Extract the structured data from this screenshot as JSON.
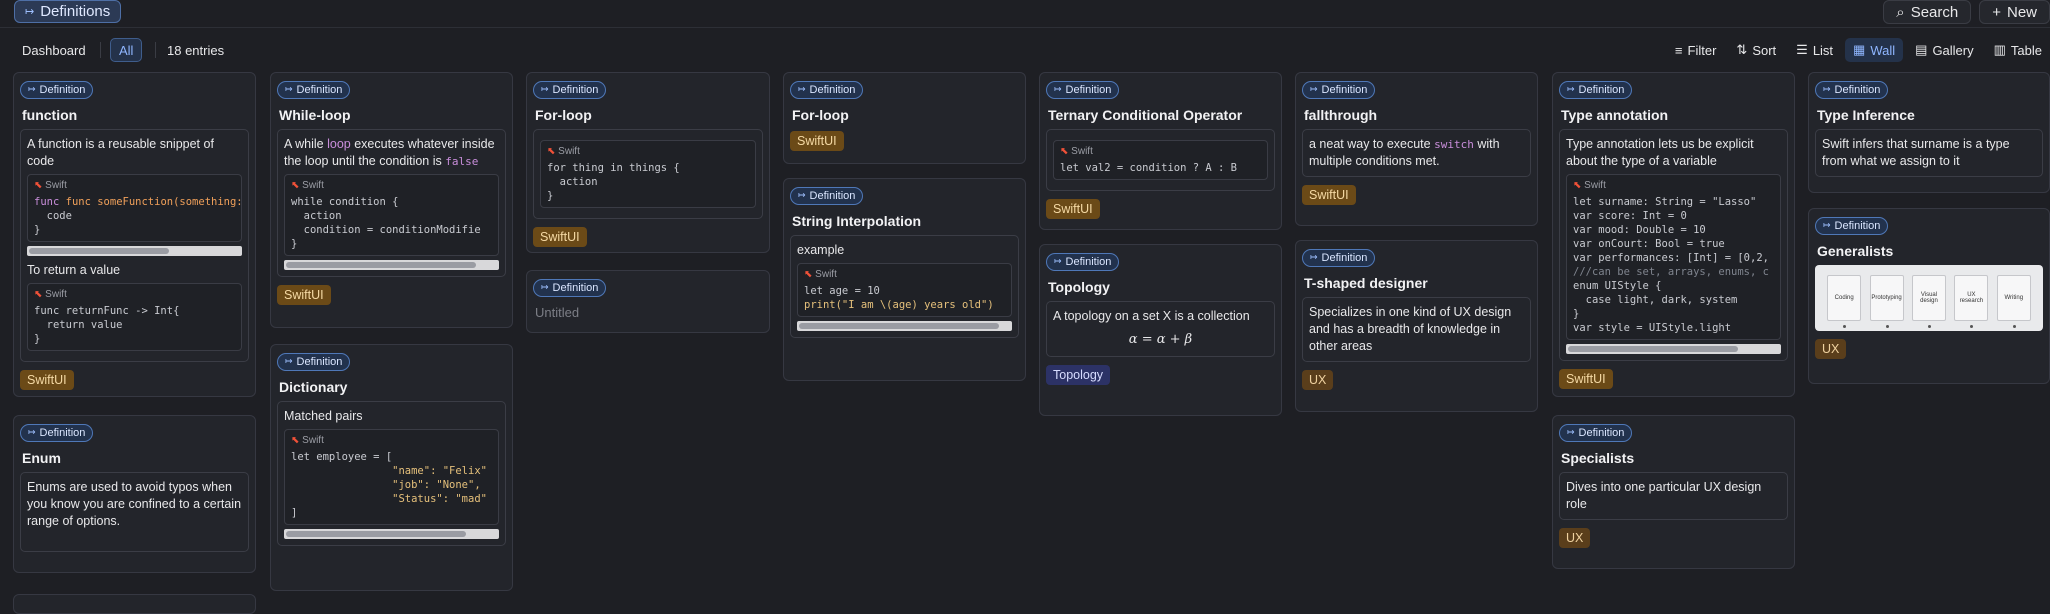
{
  "header": {
    "title": "Definitions",
    "search_label": "Search",
    "new_label": "New"
  },
  "viewbar": {
    "dashboard": "Dashboard",
    "all": "All",
    "count": "18 entries",
    "filter": "Filter",
    "sort": "Sort",
    "list": "List",
    "wall": "Wall",
    "gallery": "Gallery",
    "table": "Table",
    "active_view": "Wall"
  },
  "badge_label": "Definition",
  "lang_label": "Swift",
  "cards": {
    "function": {
      "title": "function",
      "desc": "A function is a reusable snippet of code",
      "note": "To return a value",
      "tag": "SwiftUI"
    },
    "enum": {
      "title": "Enum",
      "desc": "Enums are used to avoid typos when you know you are confined to a certain range of options."
    },
    "while": {
      "title": "While-loop",
      "desc_a": "A while ",
      "desc_kw": "loop",
      "desc_b": " executes whatever inside the loop until the condition is ",
      "desc_false": "false",
      "tag": "SwiftUI"
    },
    "dictionary": {
      "title": "Dictionary",
      "desc": "Matched pairs"
    },
    "forloop1": {
      "title": "For-loop",
      "tag": "SwiftUI"
    },
    "untitled": {
      "title": "Untitled"
    },
    "forloop2": {
      "title": "For-loop",
      "tag": "SwiftUI"
    },
    "interp": {
      "title": "String Interpolation",
      "desc": "example"
    },
    "ternary": {
      "title": "Ternary Conditional Operator",
      "tag": "SwiftUI"
    },
    "topology": {
      "title": "Topology",
      "desc": "A topology on a set X is a collection",
      "math": "α = α + β",
      "tag": "Topology"
    },
    "fallthrough": {
      "title": "fallthrough",
      "desc_a": "a neat way to execute ",
      "desc_kw": "switch",
      "desc_b": " with multiple conditions met.",
      "tag": "SwiftUI"
    },
    "tshaped": {
      "title": "T-shaped designer",
      "desc": "Specializes in one kind of UX design and has a breadth of knowledge in other areas",
      "tag": "UX"
    },
    "typeann": {
      "title": "Type annotation",
      "desc": "Type annotation lets us be explicit about the type of a variable",
      "tag": "SwiftUI"
    },
    "specialists": {
      "title": "Specialists",
      "desc": "Dives into one particular UX design role",
      "tag": "UX"
    },
    "typeinf": {
      "title": "Type Inference",
      "desc": "Swift infers that surname is a type from what we assign to it"
    },
    "generalists": {
      "title": "Generalists",
      "tag": "UX",
      "diagram_labels": [
        "Coding",
        "Prototyping",
        "Visual design",
        "UX research",
        "Writing"
      ]
    }
  },
  "code": {
    "func1": [
      "func someFunction(something: ol",
      "  code",
      "}"
    ],
    "func2": [
      "func returnFunc -> Int{",
      "  return value",
      "}"
    ],
    "while": [
      "while condition {",
      "  action",
      "  condition = conditionModifie",
      "}"
    ],
    "dict": [
      "let employee = [",
      "                \"name\": \"Felix\"",
      "                \"job\": \"None\",",
      "                \"Status\": \"mad\"",
      "]"
    ],
    "for": [
      "for thing in things {",
      "  action",
      "}"
    ],
    "interp": [
      "let age = 10",
      "print(\"I am \\(age) years old\")"
    ],
    "ternary": [
      "let val2 = condition ? A : B"
    ],
    "typeann": [
      "let surname: String = \"Lasso\"",
      "var score: Int = 0",
      "var mood: Double = 10",
      "var onCourt: Bool = true",
      "var performances: [Int] = [0,2,",
      "///can be set, arrays, enums, c",
      "enum UIStyle {",
      "  case light, dark, system",
      "}",
      "var style = UIStyle.light"
    ]
  }
}
